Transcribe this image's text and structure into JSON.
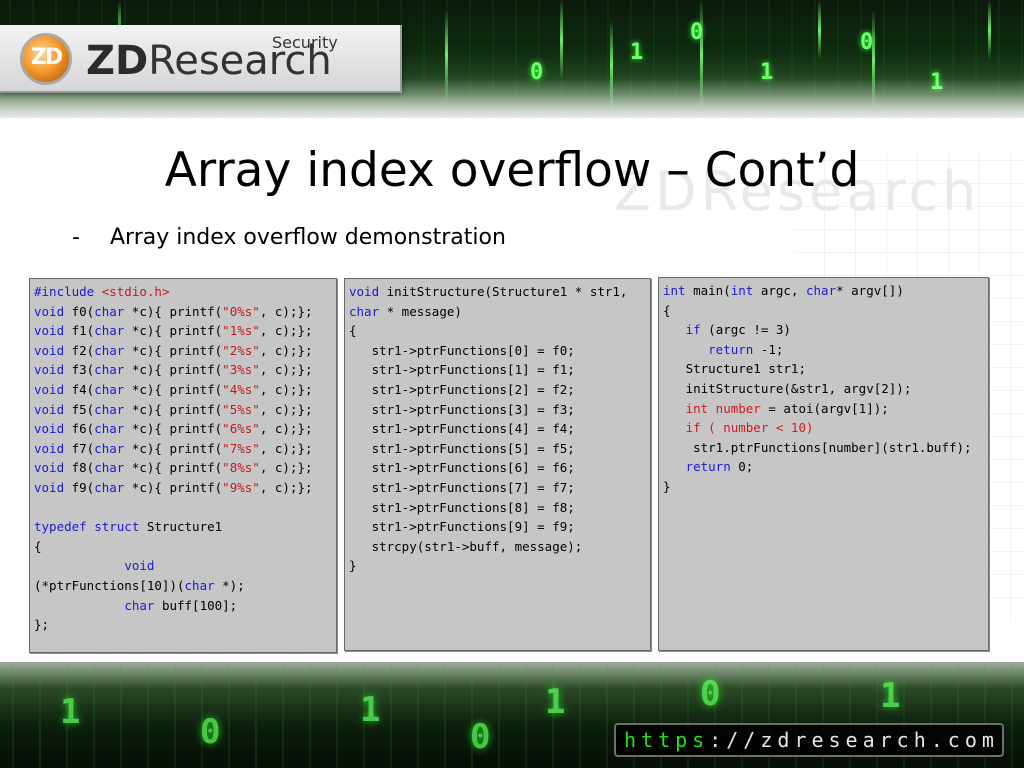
{
  "brand": {
    "logo_mark": "ZD",
    "name_prefix": "ZD",
    "name_rest": "Research",
    "tagline": "Security",
    "watermark": "ZDResearch"
  },
  "slide": {
    "title": "Array index overflow – Cont’d",
    "bullet_marker": "-",
    "bullet_text": "Array index overflow demonstration"
  },
  "code_boxes": [
    {
      "id": "code1",
      "lines": [
        [
          [
            "kw",
            "#include "
          ],
          [
            "str",
            "<stdio.h>"
          ]
        ],
        [
          [
            "kw",
            "void"
          ],
          [
            "t",
            " f0("
          ],
          [
            "kw",
            "char"
          ],
          [
            "t",
            " *c){ printf("
          ],
          [
            "str",
            "\"0%s\""
          ],
          [
            "t",
            ", c);};"
          ]
        ],
        [
          [
            "kw",
            "void"
          ],
          [
            "t",
            " f1("
          ],
          [
            "kw",
            "char"
          ],
          [
            "t",
            " *c){ printf("
          ],
          [
            "str",
            "\"1%s\""
          ],
          [
            "t",
            ", c);};"
          ]
        ],
        [
          [
            "kw",
            "void"
          ],
          [
            "t",
            " f2("
          ],
          [
            "kw",
            "char"
          ],
          [
            "t",
            " *c){ printf("
          ],
          [
            "str",
            "\"2%s\""
          ],
          [
            "t",
            ", c);};"
          ]
        ],
        [
          [
            "kw",
            "void"
          ],
          [
            "t",
            " f3("
          ],
          [
            "kw",
            "char"
          ],
          [
            "t",
            " *c){ printf("
          ],
          [
            "str",
            "\"3%s\""
          ],
          [
            "t",
            ", c);};"
          ]
        ],
        [
          [
            "kw",
            "void"
          ],
          [
            "t",
            " f4("
          ],
          [
            "kw",
            "char"
          ],
          [
            "t",
            " *c){ printf("
          ],
          [
            "str",
            "\"4%s\""
          ],
          [
            "t",
            ", c);};"
          ]
        ],
        [
          [
            "kw",
            "void"
          ],
          [
            "t",
            " f5("
          ],
          [
            "kw",
            "char"
          ],
          [
            "t",
            " *c){ printf("
          ],
          [
            "str",
            "\"5%s\""
          ],
          [
            "t",
            ", c);};"
          ]
        ],
        [
          [
            "kw",
            "void"
          ],
          [
            "t",
            " f6("
          ],
          [
            "kw",
            "char"
          ],
          [
            "t",
            " *c){ printf("
          ],
          [
            "str",
            "\"6%s\""
          ],
          [
            "t",
            ", c);};"
          ]
        ],
        [
          [
            "kw",
            "void"
          ],
          [
            "t",
            " f7("
          ],
          [
            "kw",
            "char"
          ],
          [
            "t",
            " *c){ printf("
          ],
          [
            "str",
            "\"7%s\""
          ],
          [
            "t",
            ", c);};"
          ]
        ],
        [
          [
            "kw",
            "void"
          ],
          [
            "t",
            " f8("
          ],
          [
            "kw",
            "char"
          ],
          [
            "t",
            " *c){ printf("
          ],
          [
            "str",
            "\"8%s\""
          ],
          [
            "t",
            ", c);};"
          ]
        ],
        [
          [
            "kw",
            "void"
          ],
          [
            "t",
            " f9("
          ],
          [
            "kw",
            "char"
          ],
          [
            "t",
            " *c){ printf("
          ],
          [
            "str",
            "\"9%s\""
          ],
          [
            "t",
            ", c);};"
          ]
        ],
        [
          [
            "t",
            ""
          ]
        ],
        [
          [
            "kw",
            "typedef struct"
          ],
          [
            "t",
            " Structure1"
          ]
        ],
        [
          [
            "t",
            "{"
          ]
        ],
        [
          [
            "t",
            "            "
          ],
          [
            "kw",
            "void"
          ]
        ],
        [
          [
            "t",
            "(*ptrFunctions[10])("
          ],
          [
            "kw",
            "char"
          ],
          [
            "t",
            " *);"
          ]
        ],
        [
          [
            "t",
            "            "
          ],
          [
            "kw",
            "char"
          ],
          [
            "t",
            " buff[100];"
          ]
        ],
        [
          [
            "t",
            "};"
          ]
        ]
      ]
    },
    {
      "id": "code2",
      "lines": [
        [
          [
            "kw",
            "void"
          ],
          [
            "t",
            " initStructure(Structure1 * str1,"
          ]
        ],
        [
          [
            "kw",
            "char"
          ],
          [
            "t",
            " * message)"
          ]
        ],
        [
          [
            "t",
            "{"
          ]
        ],
        [
          [
            "t",
            "   str1->ptrFunctions[0] = f0;"
          ]
        ],
        [
          [
            "t",
            "   str1->ptrFunctions[1] = f1;"
          ]
        ],
        [
          [
            "t",
            "   str1->ptrFunctions[2] = f2;"
          ]
        ],
        [
          [
            "t",
            "   str1->ptrFunctions[3] = f3;"
          ]
        ],
        [
          [
            "t",
            "   str1->ptrFunctions[4] = f4;"
          ]
        ],
        [
          [
            "t",
            "   str1->ptrFunctions[5] = f5;"
          ]
        ],
        [
          [
            "t",
            "   str1->ptrFunctions[6] = f6;"
          ]
        ],
        [
          [
            "t",
            "   str1->ptrFunctions[7] = f7;"
          ]
        ],
        [
          [
            "t",
            "   str1->ptrFunctions[8] = f8;"
          ]
        ],
        [
          [
            "t",
            "   str1->ptrFunctions[9] = f9;"
          ]
        ],
        [
          [
            "t",
            "   strcpy(str1->buff, message);"
          ]
        ],
        [
          [
            "t",
            "}"
          ]
        ]
      ]
    },
    {
      "id": "code3",
      "lines": [
        [
          [
            "kw",
            "int"
          ],
          [
            "t",
            " main("
          ],
          [
            "kw",
            "int"
          ],
          [
            "t",
            " argc, "
          ],
          [
            "kw",
            "char"
          ],
          [
            "t",
            "* argv[])"
          ]
        ],
        [
          [
            "t",
            "{"
          ]
        ],
        [
          [
            "t",
            "   "
          ],
          [
            "kw",
            "if"
          ],
          [
            "t",
            " (argc != 3)"
          ]
        ],
        [
          [
            "t",
            "      "
          ],
          [
            "kw",
            "return"
          ],
          [
            "t",
            " -1;"
          ]
        ],
        [
          [
            "t",
            "   Structure1 str1;"
          ]
        ],
        [
          [
            "t",
            "   initStructure(&str1, argv[2]);"
          ]
        ],
        [
          [
            "t",
            "   "
          ],
          [
            "num-kw",
            "int number"
          ],
          [
            "t",
            " = atoi(argv[1]);"
          ]
        ],
        [
          [
            "t",
            "   "
          ],
          [
            "num-kw",
            "if ( number < 10)"
          ]
        ],
        [
          [
            "t",
            "    str1.ptrFunctions[number](str1.buff);"
          ]
        ],
        [
          [
            "t",
            "   "
          ],
          [
            "kw",
            "return"
          ],
          [
            "t",
            " 0;"
          ]
        ],
        [
          [
            "t",
            "}"
          ]
        ]
      ]
    }
  ],
  "footer": {
    "url_scheme": "https",
    "url_rest": "://zdresearch.com"
  }
}
